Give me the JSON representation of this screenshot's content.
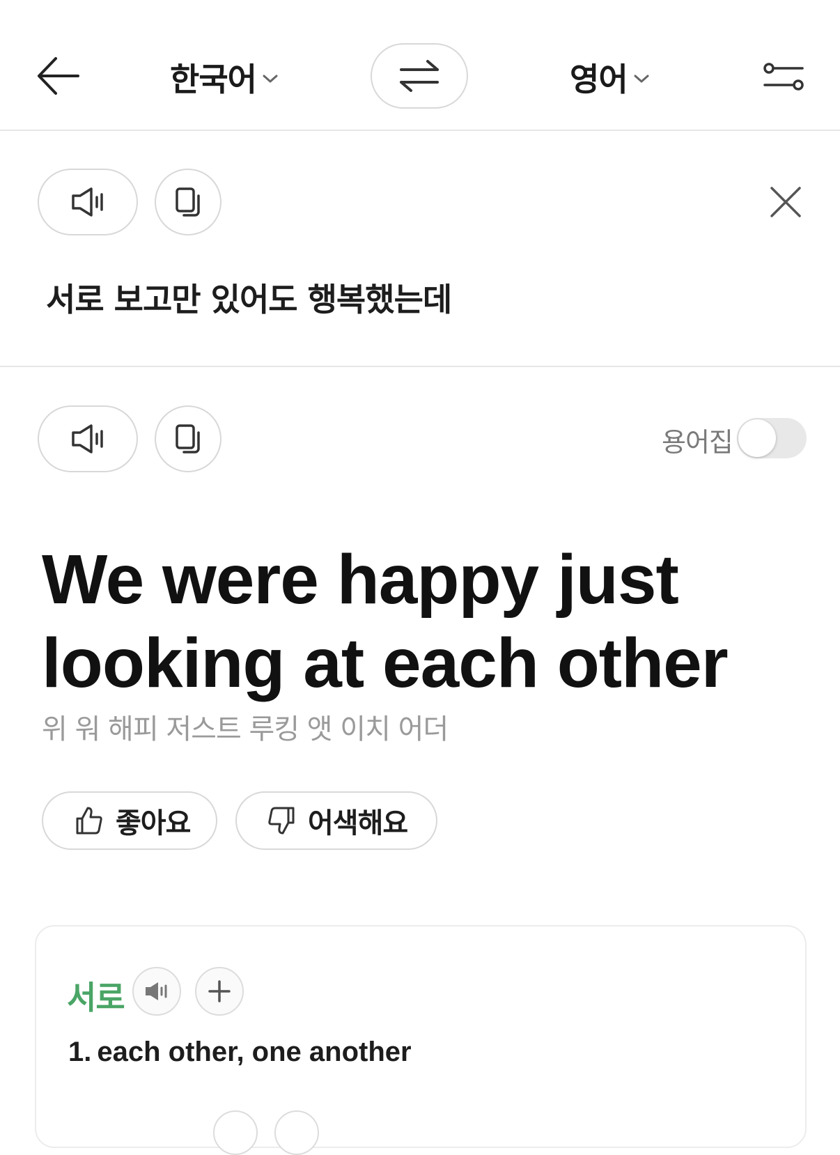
{
  "header": {
    "source_language": "한국어",
    "target_language": "영어"
  },
  "source": {
    "text": "서로 보고만 있어도 행복했는데"
  },
  "result": {
    "glossary_label": "용어집",
    "glossary_enabled": false,
    "translation": "We were happy just looking at each other",
    "pronunciation": "위 워 해피 저스트 루킹 앳 이치 어더",
    "like_label": "좋아요",
    "dislike_label": "어색해요"
  },
  "dictionary": {
    "word": "서로",
    "definition_number": "1.",
    "definition": "each other, one another"
  },
  "colors": {
    "accent_green": "#4aa566",
    "border": "#d8d8d8",
    "muted_text": "#9a9a9a"
  }
}
